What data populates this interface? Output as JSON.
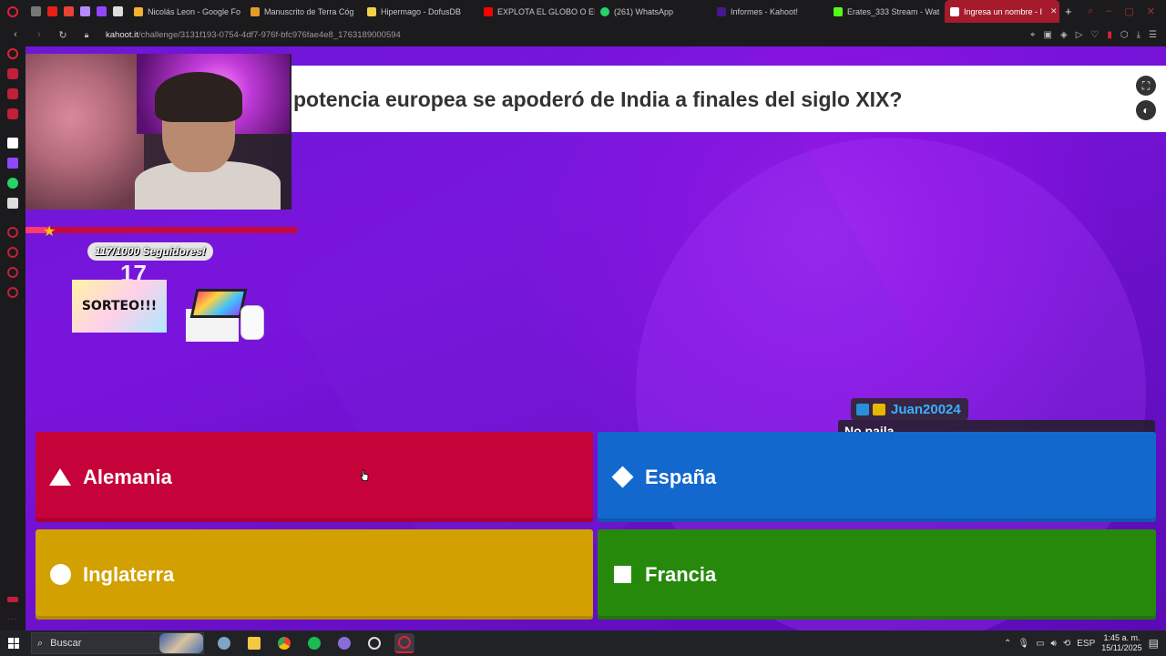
{
  "browser": {
    "tabs": [
      {
        "label": "Nicolás Leon - Google Fo",
        "color": "#f2b233"
      },
      {
        "label": "Manuscrito de Terra Cóg",
        "color": "#e39c2a"
      },
      {
        "label": "Hipermago - DofusDB",
        "color": "#f3d046"
      },
      {
        "label": "EXPLOTA EL GLOBO O EI",
        "color": "#ff0000"
      },
      {
        "label": "(261) WhatsApp",
        "color": "#25d366"
      },
      {
        "label": "Informes - Kahoot!",
        "color": "#46178f"
      },
      {
        "label": "Erates_333 Stream - Wat",
        "color": "#53fc18"
      },
      {
        "label": "Ingresa un nombre - I",
        "color": "#ffffff"
      }
    ],
    "active_tab_index": 7,
    "new_tab_label": "+",
    "url_host": "kahoot.it",
    "url_path": "/challenge/3131f193-0754-4df7-976f-bfc976fae4e8_1763189000594"
  },
  "kahoot": {
    "question": "potencia europea se apoderó de India a finales del siglo XIX?",
    "answers": {
      "red": {
        "label": "Alemania",
        "shape": "triangle-icon",
        "color": "#c6023a"
      },
      "blue": {
        "label": "España",
        "shape": "diamond-icon",
        "color": "#1368ce"
      },
      "yellow": {
        "label": "Inglaterra",
        "shape": "circle-icon",
        "color": "#d2a000"
      },
      "green": {
        "label": "Francia",
        "shape": "square-icon",
        "color": "#26890c"
      }
    },
    "fullscreen_icon": "fullscreen-icon",
    "sound_icon": "sound-icon"
  },
  "stream_overlay": {
    "follower_goal": "117/1000 Seguidores!",
    "follower_progress": 0.117,
    "counter": "17",
    "giveaway": "SORTEO!!!",
    "chat": {
      "username": "Juan20024",
      "message": "No paila"
    }
  },
  "taskbar": {
    "search_placeholder": "Buscar",
    "language": "ESP",
    "time": "1:45 a. m.",
    "date": "15/11/2025"
  }
}
